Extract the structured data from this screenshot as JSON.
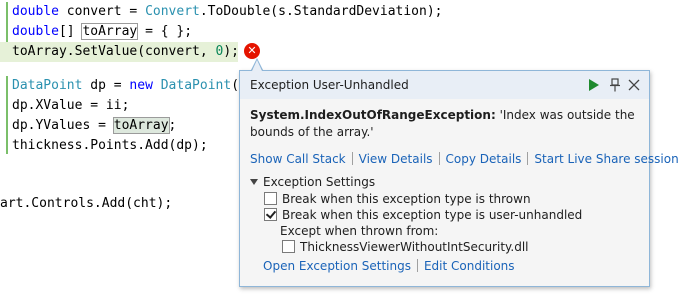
{
  "code": {
    "line1": {
      "kw": "double",
      "var": " convert = ",
      "type": "Convert",
      "rest": ".ToDouble(s.StandardDeviation);"
    },
    "line2": {
      "kw": "double",
      "brackets": "[] ",
      "ref": "toArray",
      "rest": " = { };"
    },
    "line3": {
      "pre": "toArray.SetValue(convert, ",
      "num": "0",
      "post": ");"
    },
    "line5": {
      "type": "DataPoint",
      "mid": " dp = ",
      "kw": "new",
      "sp": " ",
      "type2": "DataPoint",
      "post": "()"
    },
    "line6": "dp.XValue = ii;",
    "line7": {
      "pre": "dp.YValues = ",
      "ref": "toArray",
      "post": ";"
    },
    "line8": "thickness.Points.Add(dp);",
    "line11": "art.Controls.Add(cht);"
  },
  "popup": {
    "title": "Exception User-Unhandled",
    "exception_type": "System.IndexOutOfRangeException:",
    "exception_message": " 'Index was outside the bounds of the array.'",
    "links": {
      "show_call_stack": "Show Call Stack",
      "view_details": "View Details",
      "copy_details": "Copy Details",
      "live_share": "Start Live Share session"
    },
    "settings": {
      "header": "Exception Settings",
      "break_thrown": {
        "label": "Break when this exception type is thrown",
        "checked": false
      },
      "break_unhandled": {
        "label": "Break when this exception type is user-unhandled",
        "checked": true
      },
      "except_label": "Except when thrown from:",
      "except_module": {
        "label": "ThicknessViewerWithoutIntSecurity.dll",
        "checked": false
      }
    },
    "bottom_links": {
      "open_settings": "Open Exception Settings",
      "edit_conditions": "Edit Conditions"
    }
  },
  "colors": {
    "error_icon": "#e51400",
    "link": "#1a63b8",
    "play": "#1e8a2e",
    "header_bg": "#e8eef6"
  }
}
